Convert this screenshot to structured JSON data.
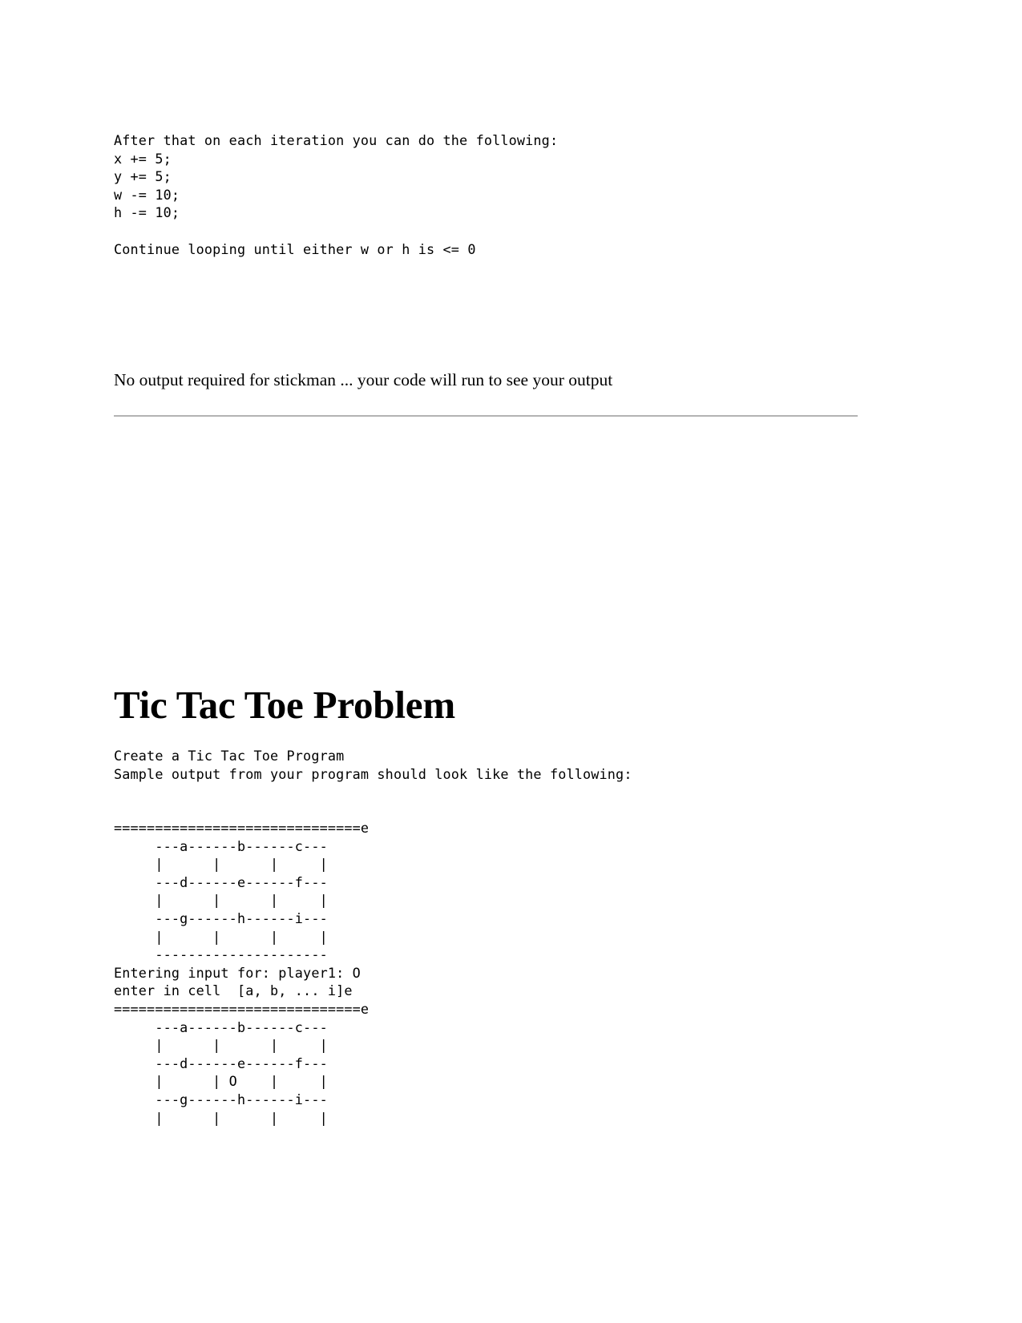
{
  "document": {
    "sections": {
      "stickman_instructions": {
        "code_lines": [
          "After that on each iteration you can do the following:",
          "x += 5;",
          "y += 5;",
          "w -= 10;",
          "h -= 10;",
          "",
          "Continue looping until either w or h is <= 0"
        ],
        "code_text": "After that on each iteration you can do the following:\nx += 5;\ny += 5;\nw -= 10;\nh -= 10;\n\nContinue looping until either w or h is <= 0",
        "note": "No output required for stickman ... your code will run to see your output"
      },
      "tic_tac_toe": {
        "heading": "Tic Tac Toe Problem",
        "description_lines": [
          "Create a Tic Tac Toe Program",
          "Sample output from your program should look like the following:"
        ],
        "description_text": "Create a Tic Tac Toe Program\nSample output from your program should look like the following:",
        "sample_output_lines": [
          "==============================e",
          "     ---a------b------c---",
          "     |      |      |     |",
          "     ---d------e------f---",
          "     |      |      |     |",
          "     ---g------h------i---",
          "     |      |      |     |",
          "     ---------------------",
          "Entering input for: player1: O",
          "enter in cell  [a, b, ... i]e",
          "==============================e",
          "     ---a------b------c---",
          "     |      |      |     |",
          "     ---d------e------f---",
          "     |      | O    |     |",
          "     ---g------h------i---",
          "     |      |      |     |"
        ],
        "sample_output_text": "==============================e\n     ---a------b------c---\n     |      |      |     |\n     ---d------e------f---\n     |      |      |     |\n     ---g------h------i---\n     |      |      |     |\n     ---------------------\nEntering input for: player1: O\nenter in cell  [a, b, ... i]e\n==============================e\n     ---a------b------c---\n     |      |      |     |\n     ---d------e------f---\n     |      | O    |     |\n     ---g------h------i---\n     |      |      |     |",
        "player_prompt": "Entering input for: player1: O",
        "cell_prompt": "enter in cell  [a, b, ... i]e",
        "player1_mark": "O",
        "cell_labels": [
          "a",
          "b",
          "c",
          "d",
          "e",
          "f",
          "g",
          "h",
          "i"
        ],
        "selected_cell": "e"
      }
    },
    "colors": {
      "text": "#000000",
      "background": "#ffffff",
      "divider": "#b3b3b3"
    }
  }
}
